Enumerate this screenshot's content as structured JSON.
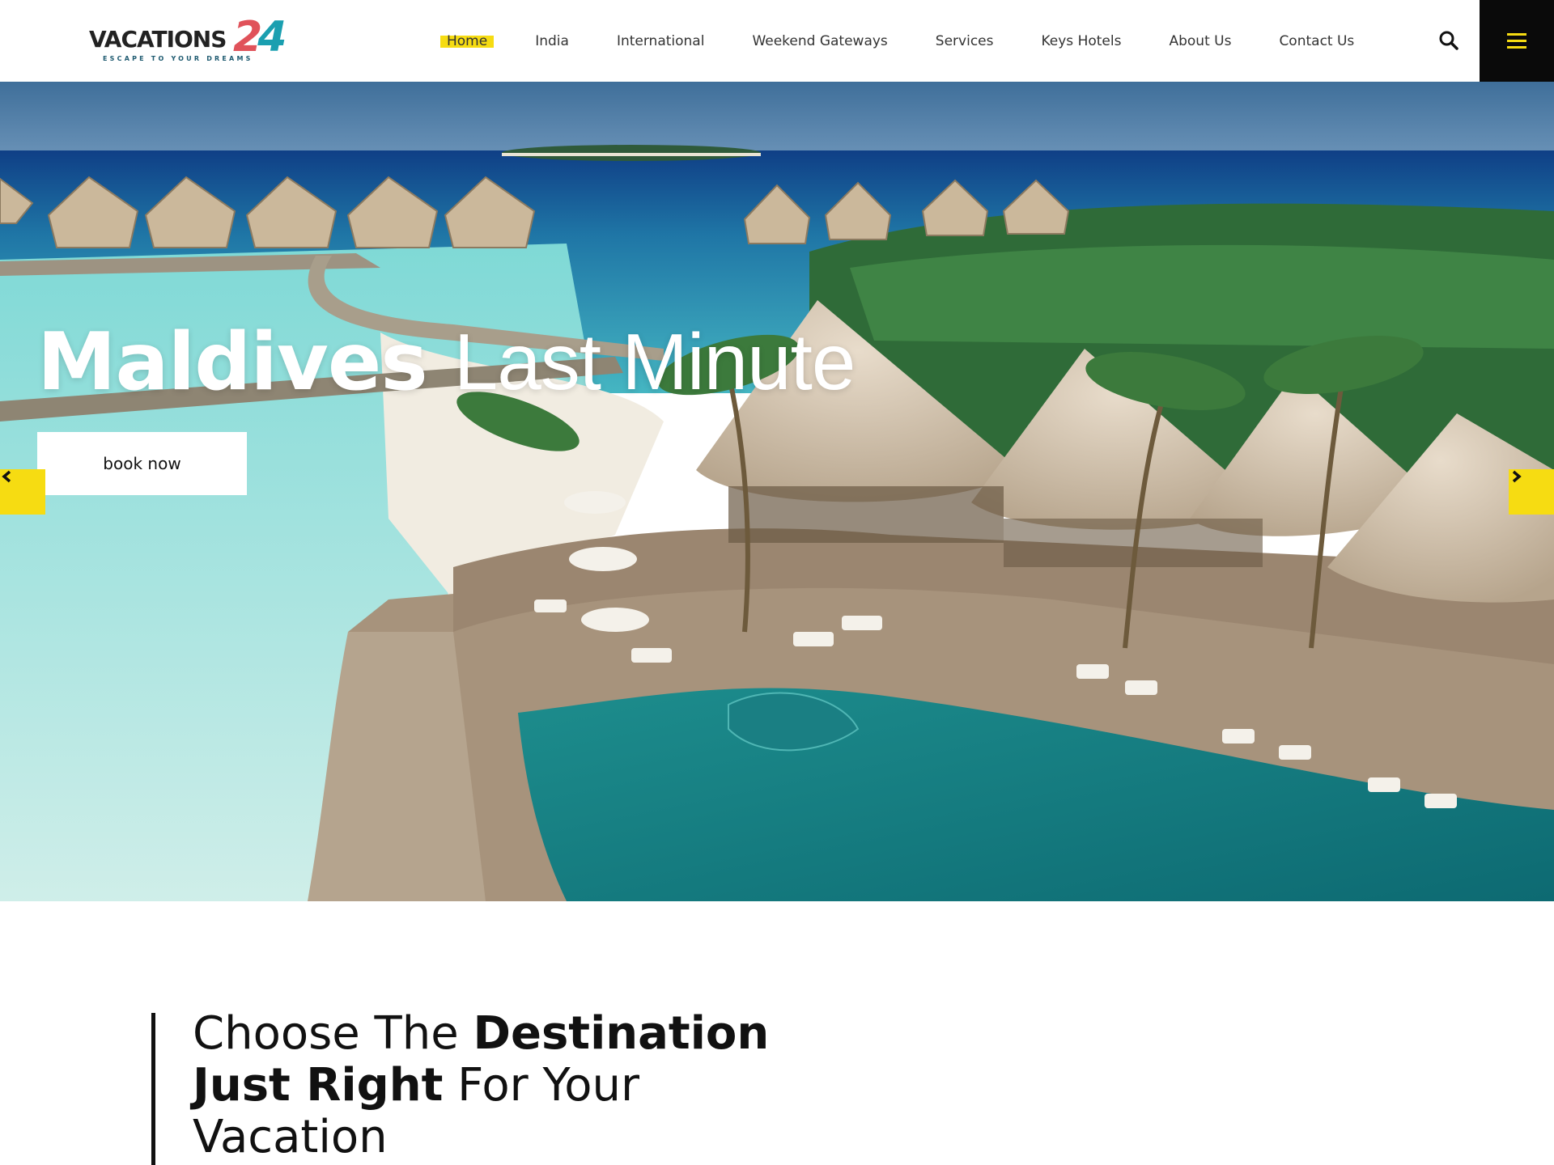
{
  "brand": {
    "logo_word": "VACATIONS",
    "logo_number_a": "2",
    "logo_number_b": "4",
    "logo_tagline": "ESCAPE TO YOUR DREAMS"
  },
  "nav": {
    "items": [
      {
        "label": "Home",
        "active": true
      },
      {
        "label": "India"
      },
      {
        "label": "International"
      },
      {
        "label": "Weekend Gateways"
      },
      {
        "label": "Services"
      },
      {
        "label": "Keys Hotels"
      },
      {
        "label": "About Us"
      },
      {
        "label": "Contact Us"
      }
    ],
    "search_icon": "search-icon",
    "menu_icon": "hamburger-menu-icon"
  },
  "hero": {
    "title_bold": "Maldives",
    "title_light": "Last Minute",
    "cta_label": "book now",
    "prev_icon": "chevron-left-icon",
    "next_icon": "chevron-right-icon"
  },
  "intro": {
    "line1_light": "Choose The ",
    "line1_bold": "Destination",
    "line2_bold": "Just Right",
    "line2_light": " For Your",
    "line3_light": "Vacation"
  },
  "colors": {
    "accent": "#f6dc12",
    "header_dark": "#0a0a0a"
  }
}
